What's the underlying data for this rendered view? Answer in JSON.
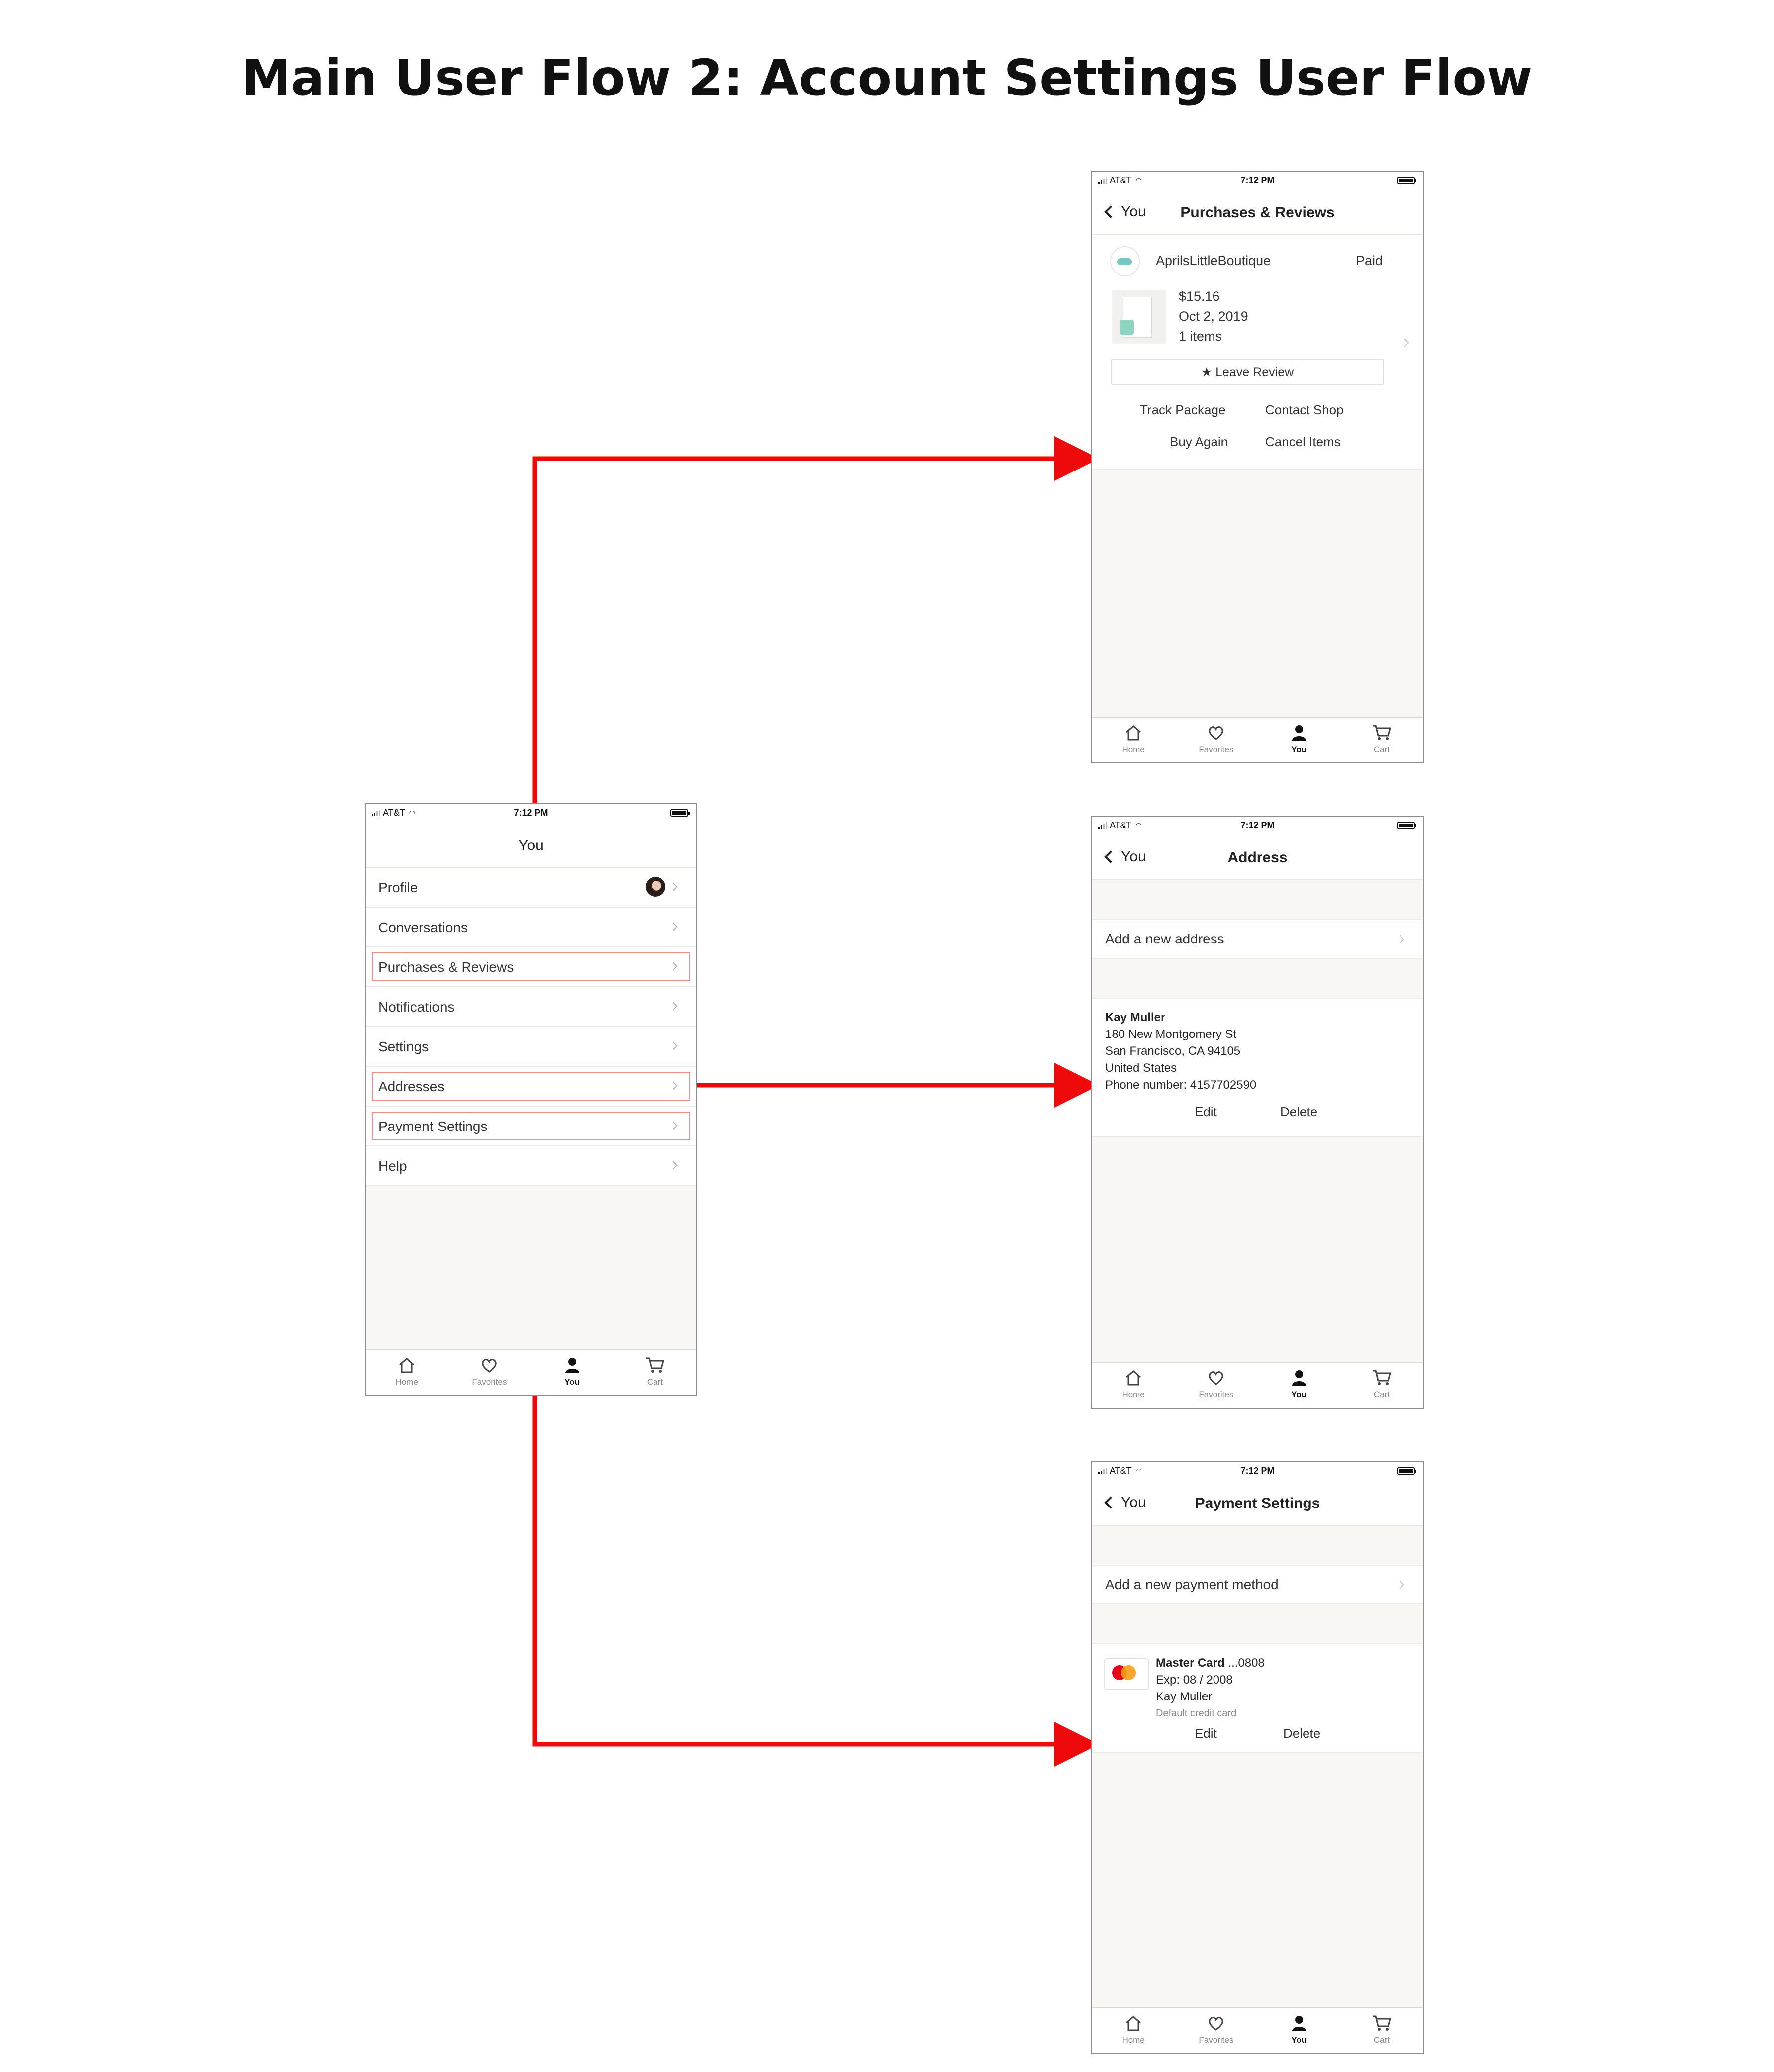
{
  "title": "Main User Flow 2: Account Settings User Flow",
  "colors": {
    "connector": "#ee0a0a",
    "highlight": "#ef8c8c",
    "screen_bg": "#f8f7f4"
  },
  "status_bar": {
    "carrier": "AT&T",
    "time": "7:12 PM"
  },
  "tab_bar": {
    "items": [
      {
        "label": "Home",
        "icon": "home-icon"
      },
      {
        "label": "Favorites",
        "icon": "heart-icon"
      },
      {
        "label": "You",
        "icon": "person-icon"
      },
      {
        "label": "Cart",
        "icon": "cart-icon"
      }
    ],
    "active": "You"
  },
  "you_screen": {
    "nav_title": "You",
    "items": [
      {
        "label": "Profile",
        "highlighted": false
      },
      {
        "label": "Conversations",
        "highlighted": false
      },
      {
        "label": "Purchases & Reviews",
        "highlighted": true
      },
      {
        "label": "Notifications",
        "highlighted": false
      },
      {
        "label": "Settings",
        "highlighted": false
      },
      {
        "label": "Addresses",
        "highlighted": true
      },
      {
        "label": "Payment Settings",
        "highlighted": true
      },
      {
        "label": "Help",
        "highlighted": false
      }
    ]
  },
  "purchases_screen": {
    "back_label": "You",
    "nav_title": "Purchases & Reviews",
    "shop_name": "AprilsLittleBoutique",
    "status": "Paid",
    "price": "$15.16",
    "date": "Oct 2, 2019",
    "items": "1 items",
    "review_button": "★ Leave Review",
    "actions": [
      "Track Package",
      "Contact Shop",
      "Buy Again",
      "Cancel Items"
    ]
  },
  "address_screen": {
    "back_label": "You",
    "nav_title": "Address",
    "add_label": "Add a new address",
    "name": "Kay Muller",
    "street": "180 New Montgomery St",
    "city": "San Francisco, CA 94105",
    "country": "United States",
    "phone": "Phone number: 4157702590",
    "edit": "Edit",
    "delete": "Delete"
  },
  "payment_screen": {
    "back_label": "You",
    "nav_title": "Payment Settings",
    "add_label": "Add a new payment method",
    "card_name": "Master Card",
    "card_suffix": " ...0808",
    "expiry": "Exp: 08 / 2008",
    "holder": "Kay Muller",
    "default_note": "Default credit card",
    "edit": "Edit",
    "delete": "Delete"
  }
}
